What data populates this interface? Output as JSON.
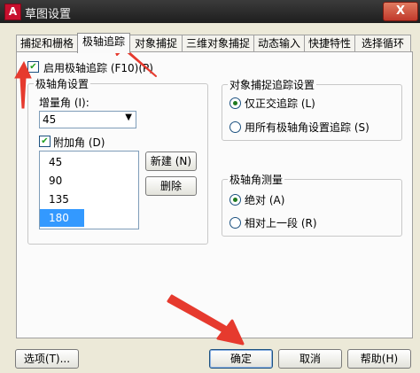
{
  "window": {
    "title": "草图设置",
    "app_icon": "A",
    "close_glyph": "X"
  },
  "tabs": [
    {
      "label": "捕捉和栅格"
    },
    {
      "label": "极轴追踪",
      "active": true
    },
    {
      "label": "对象捕捉"
    },
    {
      "label": "三维对象捕捉"
    },
    {
      "label": "动态输入"
    },
    {
      "label": "快捷特性"
    },
    {
      "label": "选择循环"
    }
  ],
  "polar": {
    "enable_label": "启用极轴追踪 (F10)(P)",
    "enable_checked": true,
    "angle_group_label": "极轴角设置",
    "increment_label": "增量角 (I):",
    "increment_value": "45",
    "additional_label": "附加角 (D)",
    "additional_checked": true,
    "angles": [
      "45",
      "90",
      "135",
      "180"
    ],
    "selected_angle": "180",
    "new_button": "新建 (N)",
    "delete_button": "删除"
  },
  "object_snap_tracking": {
    "group_label": "对象捕捉追踪设置",
    "options": [
      {
        "label": "仅正交追踪 (L)",
        "selected": true
      },
      {
        "label": "用所有极轴角设置追踪 (S)",
        "selected": false
      }
    ]
  },
  "angle_measure": {
    "group_label": "极轴角测量",
    "options": [
      {
        "label": "绝对 (A)",
        "selected": true
      },
      {
        "label": "相对上一段 (R)",
        "selected": false
      }
    ]
  },
  "footer": {
    "options_button": "选项(T)...",
    "ok_button": "确定",
    "cancel_button": "取消",
    "help_button": "帮助(H)"
  },
  "colors": {
    "annotation_arrow": "#e63a2e",
    "selected_item": "#3399ff",
    "check_mark": "#22a022"
  }
}
